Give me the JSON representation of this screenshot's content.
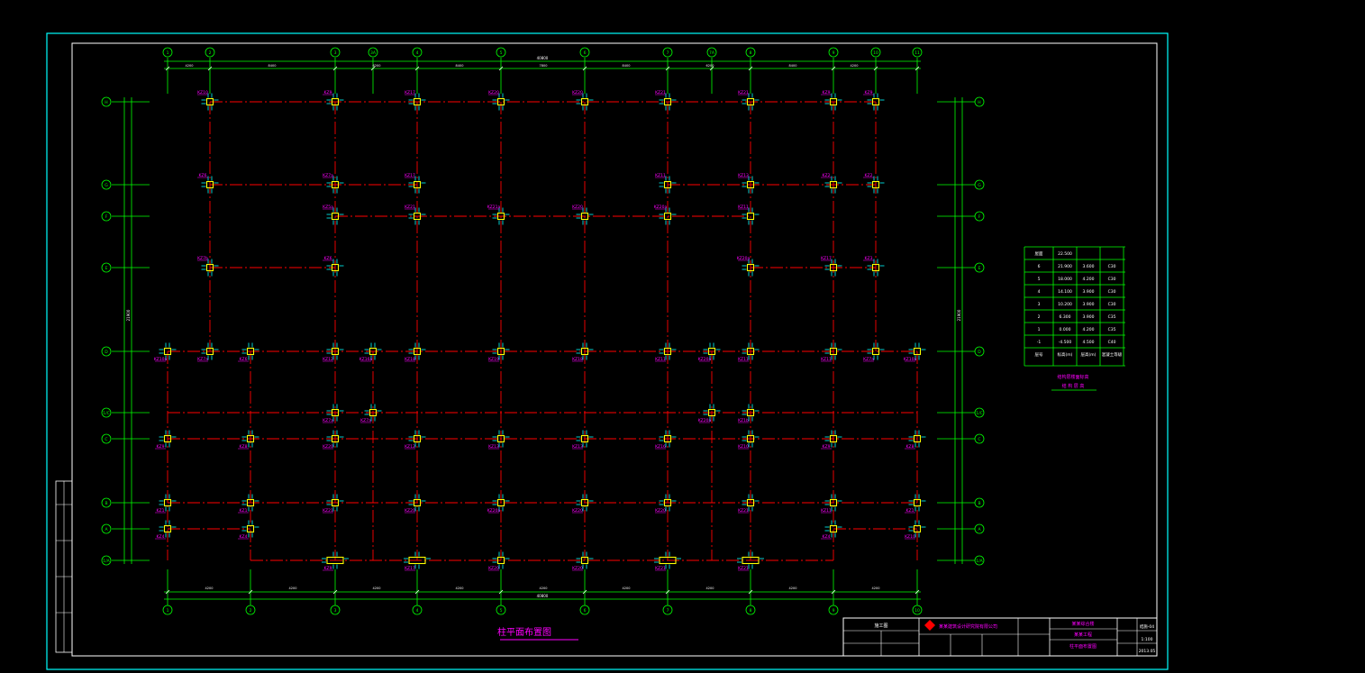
{
  "drawing": {
    "title": "柱平面布置图",
    "overall_dim_top": "40800",
    "overall_dim_bottom": "40800",
    "overall_dim_left": "21900",
    "overall_dim_right": "21900"
  },
  "axes": {
    "vertical": [
      "1",
      "2",
      "3",
      "3A",
      "4",
      "5",
      "6",
      "7",
      "7A",
      "8",
      "9",
      "10",
      "11"
    ],
    "bottom": [
      "1",
      "2",
      "3",
      "4",
      "5",
      "6",
      "7",
      "8",
      "9",
      "10"
    ],
    "horizontal": [
      "H",
      "G",
      "F",
      "E",
      "D",
      "1/C",
      "C",
      "B",
      "A",
      "1/A"
    ]
  },
  "top_dims": [
    "4200",
    "8400",
    "6200",
    "8400",
    "7800",
    "8400",
    "6200",
    "8400",
    "4200"
  ],
  "bottom_dims": [
    "4200",
    "4200",
    "4200",
    "4200",
    "4200",
    "4200",
    "4200",
    "4200",
    "4200",
    "4200"
  ],
  "column_labels": [
    "KZ10",
    "KZ9",
    "KZ17",
    "KZ20",
    "KZ20",
    "KZ21",
    "KZ21",
    "KZ9",
    "KZ9",
    "KZ6",
    "KZ7a",
    "KZ17",
    "KZ11",
    "KZ13",
    "KZ2",
    "KZ2",
    "KZ5a",
    "KZ21",
    "KZ21a",
    "KZ20",
    "KZ20a",
    "KZ11",
    "KZ7b",
    "KZ6",
    "KZ20a",
    "KZ17",
    "KZ3",
    "KZ10a",
    "KZ7a",
    "KZ6",
    "KZ12",
    "KZ16a",
    "KZ18",
    "KZ19",
    "KZ18",
    "KZ11",
    "KZ20a",
    "KZ11",
    "KZ11",
    "KZ7a",
    "KZ10a",
    "KZ7a",
    "KZ7a",
    "KZ20a",
    "KZ1b",
    "KZ9",
    "KZ8",
    "KZ20",
    "KZ12",
    "KZ13",
    "KZ13",
    "KZ16",
    "KZ10",
    "KZ9",
    "KZ8",
    "KZ1",
    "KZ1",
    "KZ21",
    "KZ20",
    "KZ20a",
    "KZ20",
    "KZ20",
    "KZ21",
    "KZ11",
    "KZ1",
    "KZ4",
    "KZ4",
    "KZ4"
  ],
  "level_table": {
    "headers": [
      "屋面",
      "22.500",
      "",
      ""
    ],
    "rows": [
      [
        "屋面",
        "22.500",
        "",
        ""
      ],
      [
        "6",
        "21.900",
        "3.600",
        "C30"
      ],
      [
        "5",
        "18.000",
        "4.200",
        "C30"
      ],
      [
        "4",
        "14.100",
        "3.900",
        "C30"
      ],
      [
        "3",
        "10.200",
        "3.900",
        "C30"
      ],
      [
        "2",
        "6.300",
        "3.900",
        "C35"
      ],
      [
        "1",
        "0.000",
        "4.200",
        "C35"
      ],
      [
        "-1",
        "-4.500",
        "4.500",
        "C40"
      ],
      [
        "层号",
        "标高(m)",
        "层高(m)",
        "混凝土等级"
      ]
    ],
    "caption_line1": "结构层楼面标高",
    "caption_line2": "结 构 层 高"
  },
  "title_block": {
    "company": "某某建筑设计研究院有限公司",
    "project": "某某综合楼",
    "sub_project": "某某工程",
    "drawing_name": "柱平面布置图",
    "stage": "施工图",
    "drawing_no": "结施-04",
    "scale": "1:100",
    "date": "2013.05"
  },
  "colors": {
    "background": "#000000",
    "frame": "#00ffff",
    "grid": "#ff0000",
    "axis": "#00ff00",
    "column": "#ffff00",
    "rebar": "#00ffff",
    "label": "#ff00ff",
    "dim": "#ffffff"
  }
}
